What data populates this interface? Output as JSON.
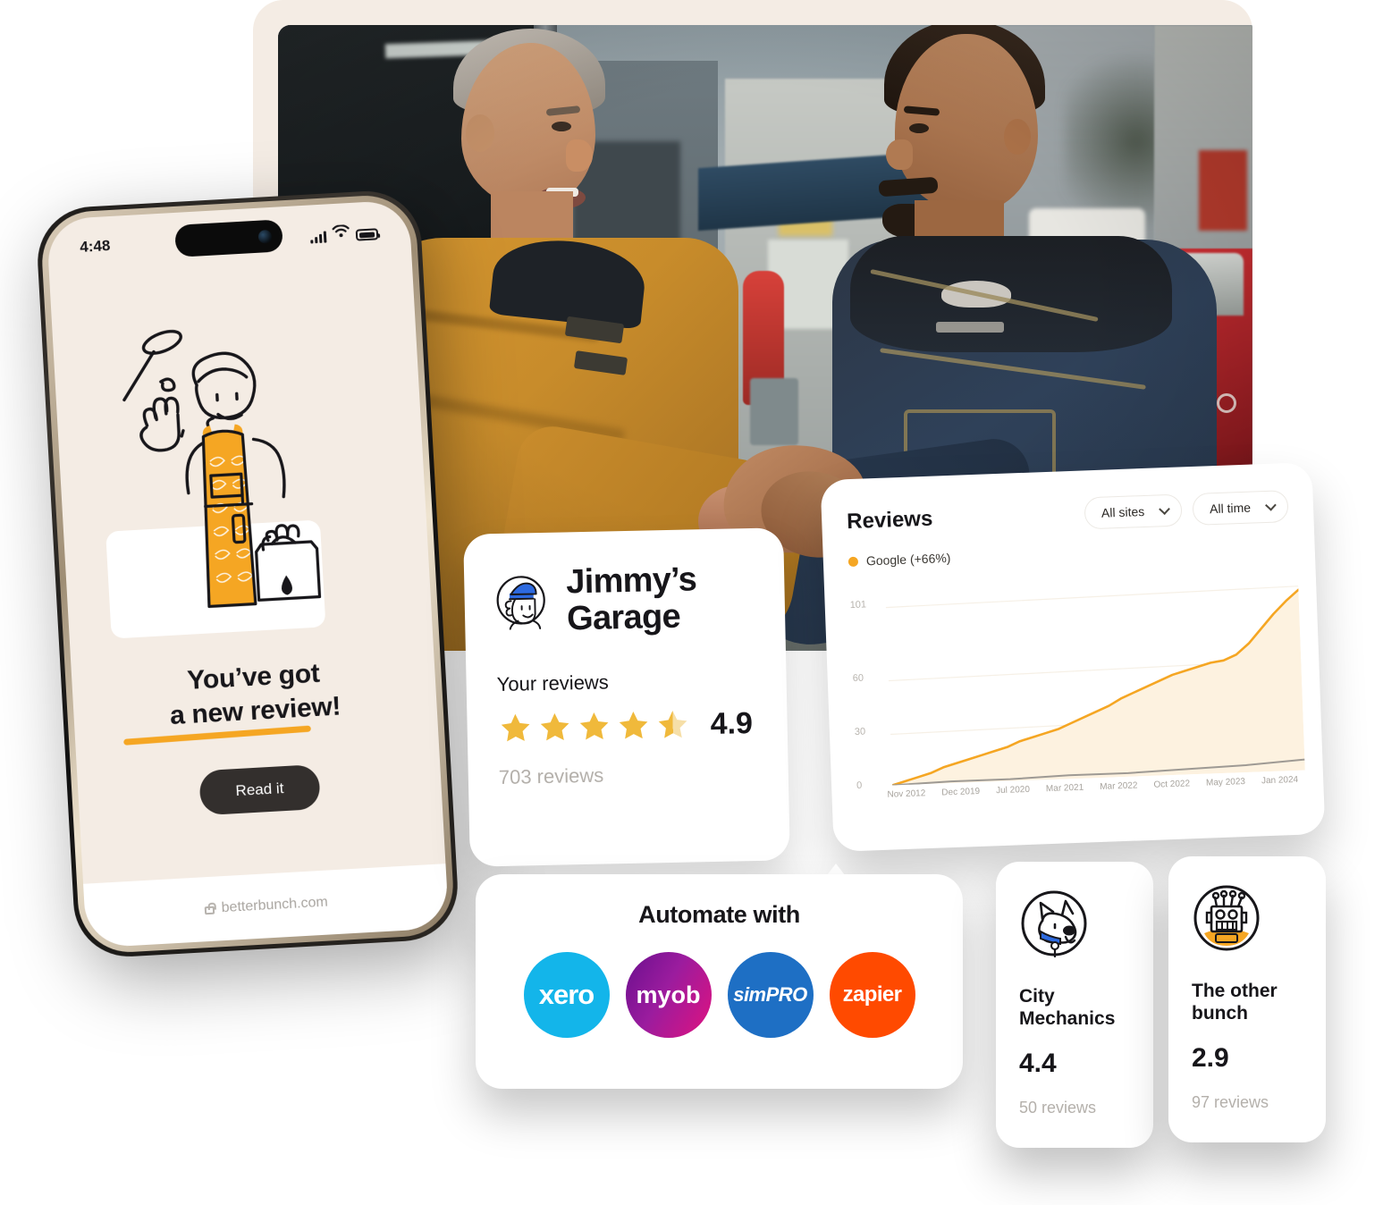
{
  "phone": {
    "status_time": "4:48",
    "status_icons": [
      "signal-icon",
      "wifi-icon",
      "battery-icon"
    ],
    "headline_line1": "You’ve got",
    "headline_line2": "a new review!",
    "cta_label": "Read it",
    "url_bar": "betterbunch.com",
    "illustration": "plumber-illustration"
  },
  "photo": {
    "alt": "two-mechanics-shaking-hands"
  },
  "business_card": {
    "avatar": "jimmy-avatar-icon",
    "name": "Jimmy’s Garage",
    "reviews_label": "Your reviews",
    "rating": "4.9",
    "stars_filled": 4,
    "stars_half": 1,
    "stars_total": 5,
    "review_count": "703 reviews"
  },
  "reviews_panel": {
    "title": "Reviews",
    "filters": [
      {
        "label": "All sites",
        "icon": "chevron-down-icon"
      },
      {
        "label": "All time",
        "icon": "chevron-down-icon"
      }
    ],
    "legend": {
      "label": "Google (+66%)",
      "color": "#F5A623"
    }
  },
  "chart_data": {
    "type": "area",
    "title": "Reviews",
    "xlabel": "",
    "ylabel": "",
    "ylim": [
      0,
      115
    ],
    "yticks": [
      0,
      30,
      60,
      101
    ],
    "ytick_labels": [
      "0",
      "30",
      "60",
      "101"
    ],
    "grid": true,
    "legend_position": "top-left",
    "x": [
      "Nov 2012",
      "Dec 2019",
      "Jul 2020",
      "Mar 2021",
      "Mar 2022",
      "Oct 2022",
      "May 2023",
      "Jan 2024"
    ],
    "series": [
      {
        "name": "Google (+66%)",
        "color": "#F5A623",
        "fill": "#FDF2E0",
        "values": [
          0,
          13,
          22,
          31,
          47,
          57,
          63,
          101
        ],
        "dense_values": [
          0,
          2,
          4,
          6,
          9,
          11,
          13,
          15,
          17,
          19,
          22,
          24,
          26,
          28,
          31,
          34,
          37,
          40,
          44,
          47,
          50,
          53,
          56,
          58,
          60,
          62,
          63,
          66,
          72,
          80,
          88,
          95,
          101
        ]
      },
      {
        "name": "baseline",
        "color": "#9e9a94",
        "values": [
          0,
          1,
          1,
          2,
          2,
          3,
          4,
          6
        ]
      }
    ]
  },
  "automate": {
    "title": "Automate with",
    "logos": [
      {
        "name": "xero",
        "label": "xero",
        "color": "#13B5EA"
      },
      {
        "name": "myob",
        "label": "myob",
        "color": "#9B1C9E"
      },
      {
        "name": "simpro",
        "label": "simPRO",
        "color": "#1E6FC4"
      },
      {
        "name": "zapier",
        "label": "zapier",
        "color": "#FF4A00"
      }
    ]
  },
  "competitors": [
    {
      "avatar": "dog-avatar-icon",
      "name": "City Mechanics",
      "score": "4.4",
      "count": "50 reviews"
    },
    {
      "avatar": "robot-avatar-icon",
      "name": "The other bunch",
      "score": "2.9",
      "count": "97 reviews"
    }
  ],
  "theme": {
    "accent": "#F5A623",
    "cream": "#f4ece4",
    "dark": "#332F2D",
    "muted": "#b4b0ab"
  }
}
